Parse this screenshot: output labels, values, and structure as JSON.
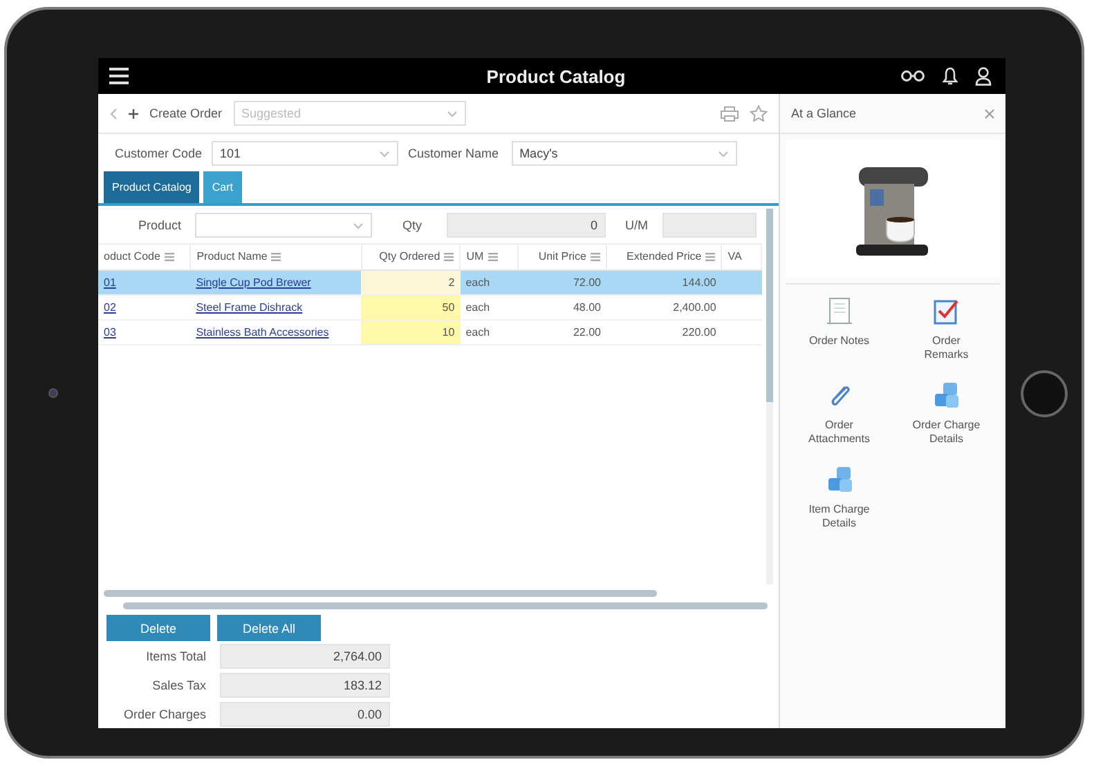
{
  "app_bar": {
    "title": "Product Catalog"
  },
  "toolbar": {
    "create_label": "Create Order",
    "view_field": {
      "placeholder": "Suggested"
    }
  },
  "customer": {
    "code_label": "Customer Code",
    "code": "101",
    "name_label": "Customer Name",
    "name": "Macy's"
  },
  "tabs": [
    {
      "label": "Product Catalog",
      "selected": true
    },
    {
      "label": "Cart",
      "selected": false
    }
  ],
  "entry": {
    "product_label": "Product",
    "qty_label": "Qty",
    "qty": "0",
    "um_label": "U/M"
  },
  "table": {
    "columns": [
      "oduct Code",
      "Product Name",
      "Qty Ordered",
      "UM",
      "Unit Price",
      "Extended Price",
      "VA"
    ],
    "rows": [
      {
        "selected": true,
        "cells": [
          "01",
          "Single Cup Pod Brewer",
          "2",
          "each",
          "72.00",
          "144.00"
        ]
      },
      {
        "selected": false,
        "cells": [
          "02",
          "Steel Frame Dishrack",
          "50",
          "each",
          "48.00",
          "2,400.00"
        ]
      },
      {
        "selected": false,
        "cells": [
          "03",
          "Stainless Bath Accessories",
          "10",
          "each",
          "22.00",
          "220.00"
        ]
      }
    ]
  },
  "buttons": [
    "Delete",
    "Delete All"
  ],
  "totals": [
    {
      "label": "Items Total",
      "value": "2,764.00"
    },
    {
      "label": "Sales Tax",
      "value": "183.12"
    },
    {
      "label": "Order Charges",
      "value": "0.00"
    }
  ],
  "glance": {
    "title": "At a Glance",
    "actions": [
      {
        "kind": "notes",
        "label": "Order Notes"
      },
      {
        "kind": "remarks",
        "label": "Order Remarks"
      },
      {
        "kind": "attachments",
        "label": "Order Attachments"
      },
      {
        "kind": "charges",
        "label": "Order Charge Details"
      },
      {
        "kind": "charges",
        "label": "Item Charge Details"
      }
    ]
  }
}
